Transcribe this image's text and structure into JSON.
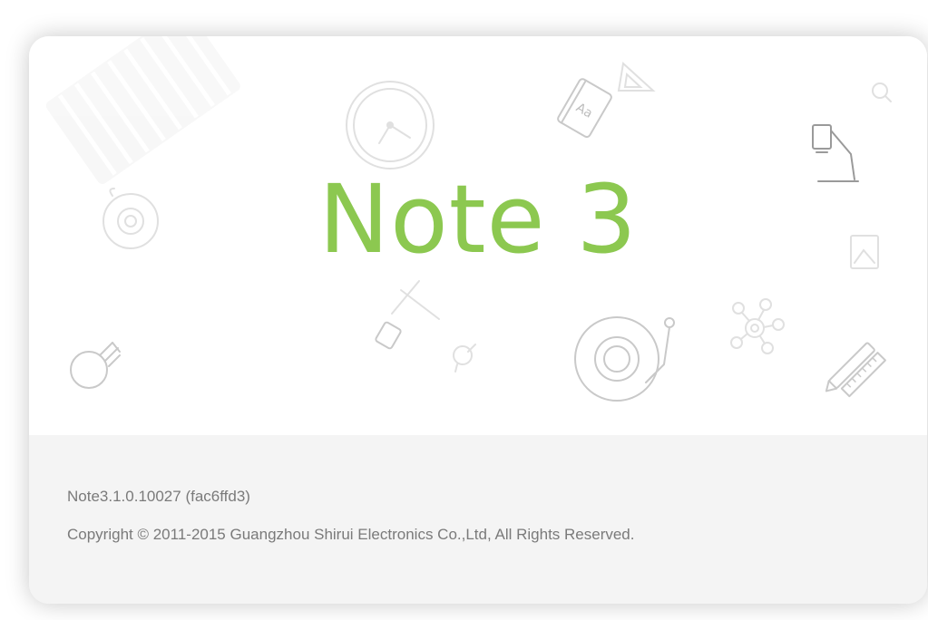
{
  "app": {
    "title": "Note 3",
    "version": "Note3.1.0.10027 (fac6ffd3)",
    "copyright": "Copyright © 2011-2015 Guangzhou Shirui Electronics Co.,Ltd, All Rights Reserved.",
    "accent_color": "#8cc850"
  },
  "decorations": {
    "book_label": "Aa",
    "icons": [
      "piano-keys-icon",
      "clock-icon",
      "book-icon",
      "triangle-ruler-icon",
      "bulb-small-icon",
      "desk-lamp-icon",
      "disc-icon",
      "photo-icon",
      "pen-icon",
      "bulb-icon",
      "bulb-faint-icon",
      "turntable-icon",
      "network-icon",
      "pencil-ruler-icon"
    ]
  }
}
